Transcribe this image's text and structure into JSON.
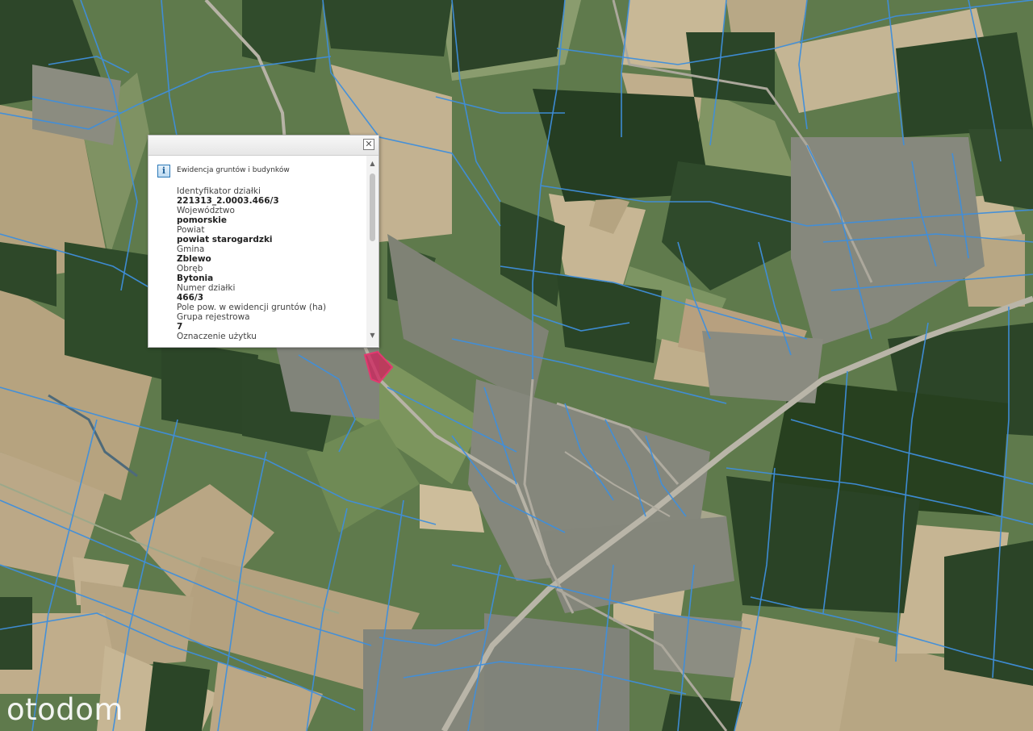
{
  "popup": {
    "close_symbol": "✕",
    "info_icon_symbol": "i",
    "layer_title": "Ewidencja gruntów i budynków",
    "attributes": [
      {
        "label": "Identyfikator działki",
        "value": "221313_2.0003.466/3"
      },
      {
        "label": "Województwo",
        "value": "pomorskie"
      },
      {
        "label": "Powiat",
        "value": "powiat starogardzki"
      },
      {
        "label": "Gmina",
        "value": "Zblewo"
      },
      {
        "label": "Obręb",
        "value": "Bytonia"
      },
      {
        "label": "Numer działki",
        "value": "466/3"
      },
      {
        "label": "Pole pow. w ewidencji gruntów (ha)",
        "value": ""
      },
      {
        "label": "Grupa rejestrowa",
        "value": "7"
      },
      {
        "label": "Oznaczenie użytku",
        "value": ""
      }
    ]
  },
  "scrollbar": {
    "up_symbol": "▲",
    "down_symbol": "▼"
  },
  "watermark": {
    "text": "otodom"
  },
  "colors": {
    "parcel_line": "#3f8fdc",
    "highlight_fill": "#d0205c",
    "popup_bg": "#ffffff",
    "forest": "#2f4a2b",
    "field": "#c2b090",
    "meadow": "#6b8552"
  },
  "icons": [
    "close-icon",
    "info-icon",
    "scroll-up-icon",
    "scroll-down-icon"
  ]
}
